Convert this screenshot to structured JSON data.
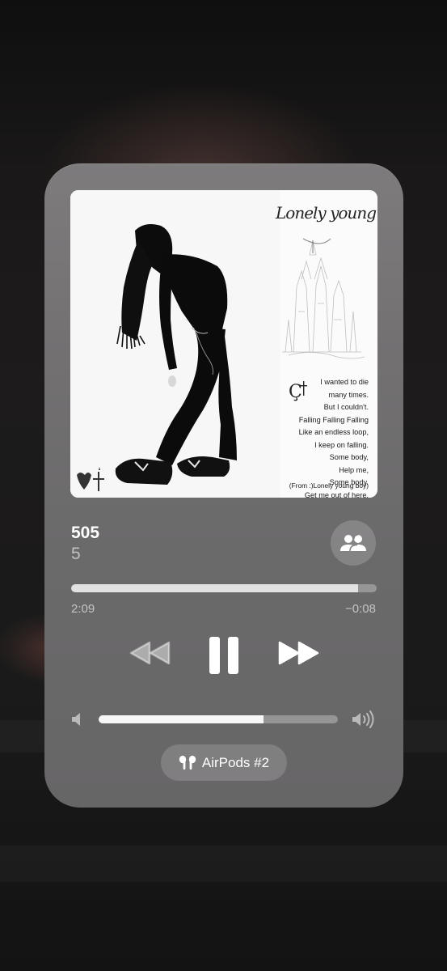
{
  "now_playing": {
    "title": "505",
    "artist": "5",
    "elapsed": "2:09",
    "remaining": "−0:08",
    "progress": 0.94,
    "volume": 0.69,
    "is_playing": true
  },
  "artwork": {
    "script_title": "Lonely young boy",
    "lyrics": [
      "I wanted to die",
      "many times.",
      "But I couldn't.",
      "Falling Falling Falling",
      "Like an endless loop,",
      "I keep on falling.",
      "Some body,",
      "Help me,",
      "Some body.",
      "Get me out of here."
    ],
    "from_label": "(From :)Lonely young boy)"
  },
  "output_route": {
    "label": "AirPods #2",
    "icon": "airpods-icon"
  },
  "icons": {
    "share": "shareplay-people-icon",
    "previous": "rewind-icon",
    "play_pause": "pause-icon",
    "next": "fast-forward-icon",
    "volume_low": "speaker-low-icon",
    "volume_high": "speaker-high-icon"
  },
  "colors": {
    "player_bg": "#727071",
    "text_primary": "#ffffff",
    "text_secondary": "#bdbcbd"
  }
}
